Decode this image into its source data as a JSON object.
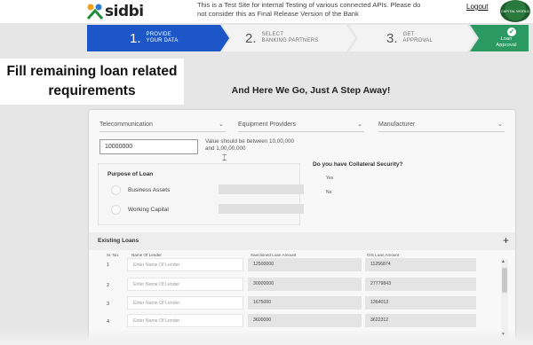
{
  "header": {
    "logo": "sidbi",
    "notice": "This is a Test Site for internal Testing of various connected APIs. Please do not consider this as Final Release Version of the Bank",
    "logout": "Logout",
    "partner_logo": "CAPITAL WORLD"
  },
  "stepper": [
    {
      "num": "1.",
      "label1": "PROVIDE",
      "label2": "YOUR DATA"
    },
    {
      "num": "2.",
      "label1": "SELECT",
      "label2": "BANKING PARTNERS"
    },
    {
      "num": "3.",
      "label1": "GET",
      "label2": "APPROVAL"
    },
    {
      "num": "",
      "label1": "Loan",
      "label2": "Approval"
    }
  ],
  "caption": {
    "line1": "Fill remaining loan related",
    "line2": "requirements"
  },
  "subtitle": "And Here We Go, Just A Step Away!",
  "dropdowns": [
    "Telecommunication",
    "Equipment Providers",
    "Manufacturer"
  ],
  "amount": {
    "value": "10000000",
    "hint": "Value should be between 10,00,000 and 1,00,00,000"
  },
  "purpose": {
    "title": "Purpose of Loan",
    "options": [
      "Business Assets",
      "Working Capital"
    ]
  },
  "collateral": {
    "question": "Do you have Collateral Security?",
    "options": [
      "Yes",
      "No"
    ]
  },
  "existing_loans": {
    "title": "Existing Loans",
    "add": "+",
    "columns": [
      "Sr. No.",
      "Name Of Lender",
      "Sanctioned Loan Amount",
      "O/S Loan Amount"
    ],
    "rows": [
      {
        "no": "1",
        "lender_placeholder": "Enter Name Of Lender",
        "sanctioned": "12500000",
        "os": "11256874"
      },
      {
        "no": "2",
        "lender_placeholder": "Enter Name Of Lender",
        "sanctioned": "30000000",
        "os": "27779843"
      },
      {
        "no": "3",
        "lender_placeholder": "Enter Name Of Lender",
        "sanctioned": "1675000",
        "os": "1364013"
      },
      {
        "no": "4",
        "lender_placeholder": "Enter Name Of Lender",
        "sanctioned": "3600000",
        "os": "3622312"
      }
    ]
  }
}
